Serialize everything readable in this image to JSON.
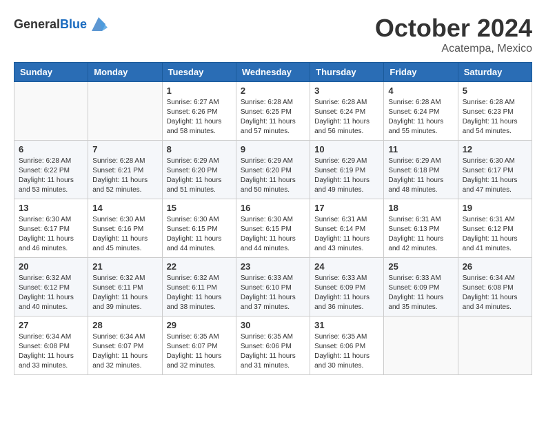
{
  "header": {
    "logo_general": "General",
    "logo_blue": "Blue",
    "month": "October 2024",
    "location": "Acatempa, Mexico"
  },
  "weekdays": [
    "Sunday",
    "Monday",
    "Tuesday",
    "Wednesday",
    "Thursday",
    "Friday",
    "Saturday"
  ],
  "weeks": [
    [
      {
        "day": "",
        "info": ""
      },
      {
        "day": "",
        "info": ""
      },
      {
        "day": "1",
        "info": "Sunrise: 6:27 AM\nSunset: 6:26 PM\nDaylight: 11 hours and 58 minutes."
      },
      {
        "day": "2",
        "info": "Sunrise: 6:28 AM\nSunset: 6:25 PM\nDaylight: 11 hours and 57 minutes."
      },
      {
        "day": "3",
        "info": "Sunrise: 6:28 AM\nSunset: 6:24 PM\nDaylight: 11 hours and 56 minutes."
      },
      {
        "day": "4",
        "info": "Sunrise: 6:28 AM\nSunset: 6:24 PM\nDaylight: 11 hours and 55 minutes."
      },
      {
        "day": "5",
        "info": "Sunrise: 6:28 AM\nSunset: 6:23 PM\nDaylight: 11 hours and 54 minutes."
      }
    ],
    [
      {
        "day": "6",
        "info": "Sunrise: 6:28 AM\nSunset: 6:22 PM\nDaylight: 11 hours and 53 minutes."
      },
      {
        "day": "7",
        "info": "Sunrise: 6:28 AM\nSunset: 6:21 PM\nDaylight: 11 hours and 52 minutes."
      },
      {
        "day": "8",
        "info": "Sunrise: 6:29 AM\nSunset: 6:20 PM\nDaylight: 11 hours and 51 minutes."
      },
      {
        "day": "9",
        "info": "Sunrise: 6:29 AM\nSunset: 6:20 PM\nDaylight: 11 hours and 50 minutes."
      },
      {
        "day": "10",
        "info": "Sunrise: 6:29 AM\nSunset: 6:19 PM\nDaylight: 11 hours and 49 minutes."
      },
      {
        "day": "11",
        "info": "Sunrise: 6:29 AM\nSunset: 6:18 PM\nDaylight: 11 hours and 48 minutes."
      },
      {
        "day": "12",
        "info": "Sunrise: 6:30 AM\nSunset: 6:17 PM\nDaylight: 11 hours and 47 minutes."
      }
    ],
    [
      {
        "day": "13",
        "info": "Sunrise: 6:30 AM\nSunset: 6:17 PM\nDaylight: 11 hours and 46 minutes."
      },
      {
        "day": "14",
        "info": "Sunrise: 6:30 AM\nSunset: 6:16 PM\nDaylight: 11 hours and 45 minutes."
      },
      {
        "day": "15",
        "info": "Sunrise: 6:30 AM\nSunset: 6:15 PM\nDaylight: 11 hours and 44 minutes."
      },
      {
        "day": "16",
        "info": "Sunrise: 6:30 AM\nSunset: 6:15 PM\nDaylight: 11 hours and 44 minutes."
      },
      {
        "day": "17",
        "info": "Sunrise: 6:31 AM\nSunset: 6:14 PM\nDaylight: 11 hours and 43 minutes."
      },
      {
        "day": "18",
        "info": "Sunrise: 6:31 AM\nSunset: 6:13 PM\nDaylight: 11 hours and 42 minutes."
      },
      {
        "day": "19",
        "info": "Sunrise: 6:31 AM\nSunset: 6:12 PM\nDaylight: 11 hours and 41 minutes."
      }
    ],
    [
      {
        "day": "20",
        "info": "Sunrise: 6:32 AM\nSunset: 6:12 PM\nDaylight: 11 hours and 40 minutes."
      },
      {
        "day": "21",
        "info": "Sunrise: 6:32 AM\nSunset: 6:11 PM\nDaylight: 11 hours and 39 minutes."
      },
      {
        "day": "22",
        "info": "Sunrise: 6:32 AM\nSunset: 6:11 PM\nDaylight: 11 hours and 38 minutes."
      },
      {
        "day": "23",
        "info": "Sunrise: 6:33 AM\nSunset: 6:10 PM\nDaylight: 11 hours and 37 minutes."
      },
      {
        "day": "24",
        "info": "Sunrise: 6:33 AM\nSunset: 6:09 PM\nDaylight: 11 hours and 36 minutes."
      },
      {
        "day": "25",
        "info": "Sunrise: 6:33 AM\nSunset: 6:09 PM\nDaylight: 11 hours and 35 minutes."
      },
      {
        "day": "26",
        "info": "Sunrise: 6:34 AM\nSunset: 6:08 PM\nDaylight: 11 hours and 34 minutes."
      }
    ],
    [
      {
        "day": "27",
        "info": "Sunrise: 6:34 AM\nSunset: 6:08 PM\nDaylight: 11 hours and 33 minutes."
      },
      {
        "day": "28",
        "info": "Sunrise: 6:34 AM\nSunset: 6:07 PM\nDaylight: 11 hours and 32 minutes."
      },
      {
        "day": "29",
        "info": "Sunrise: 6:35 AM\nSunset: 6:07 PM\nDaylight: 11 hours and 32 minutes."
      },
      {
        "day": "30",
        "info": "Sunrise: 6:35 AM\nSunset: 6:06 PM\nDaylight: 11 hours and 31 minutes."
      },
      {
        "day": "31",
        "info": "Sunrise: 6:35 AM\nSunset: 6:06 PM\nDaylight: 11 hours and 30 minutes."
      },
      {
        "day": "",
        "info": ""
      },
      {
        "day": "",
        "info": ""
      }
    ]
  ]
}
